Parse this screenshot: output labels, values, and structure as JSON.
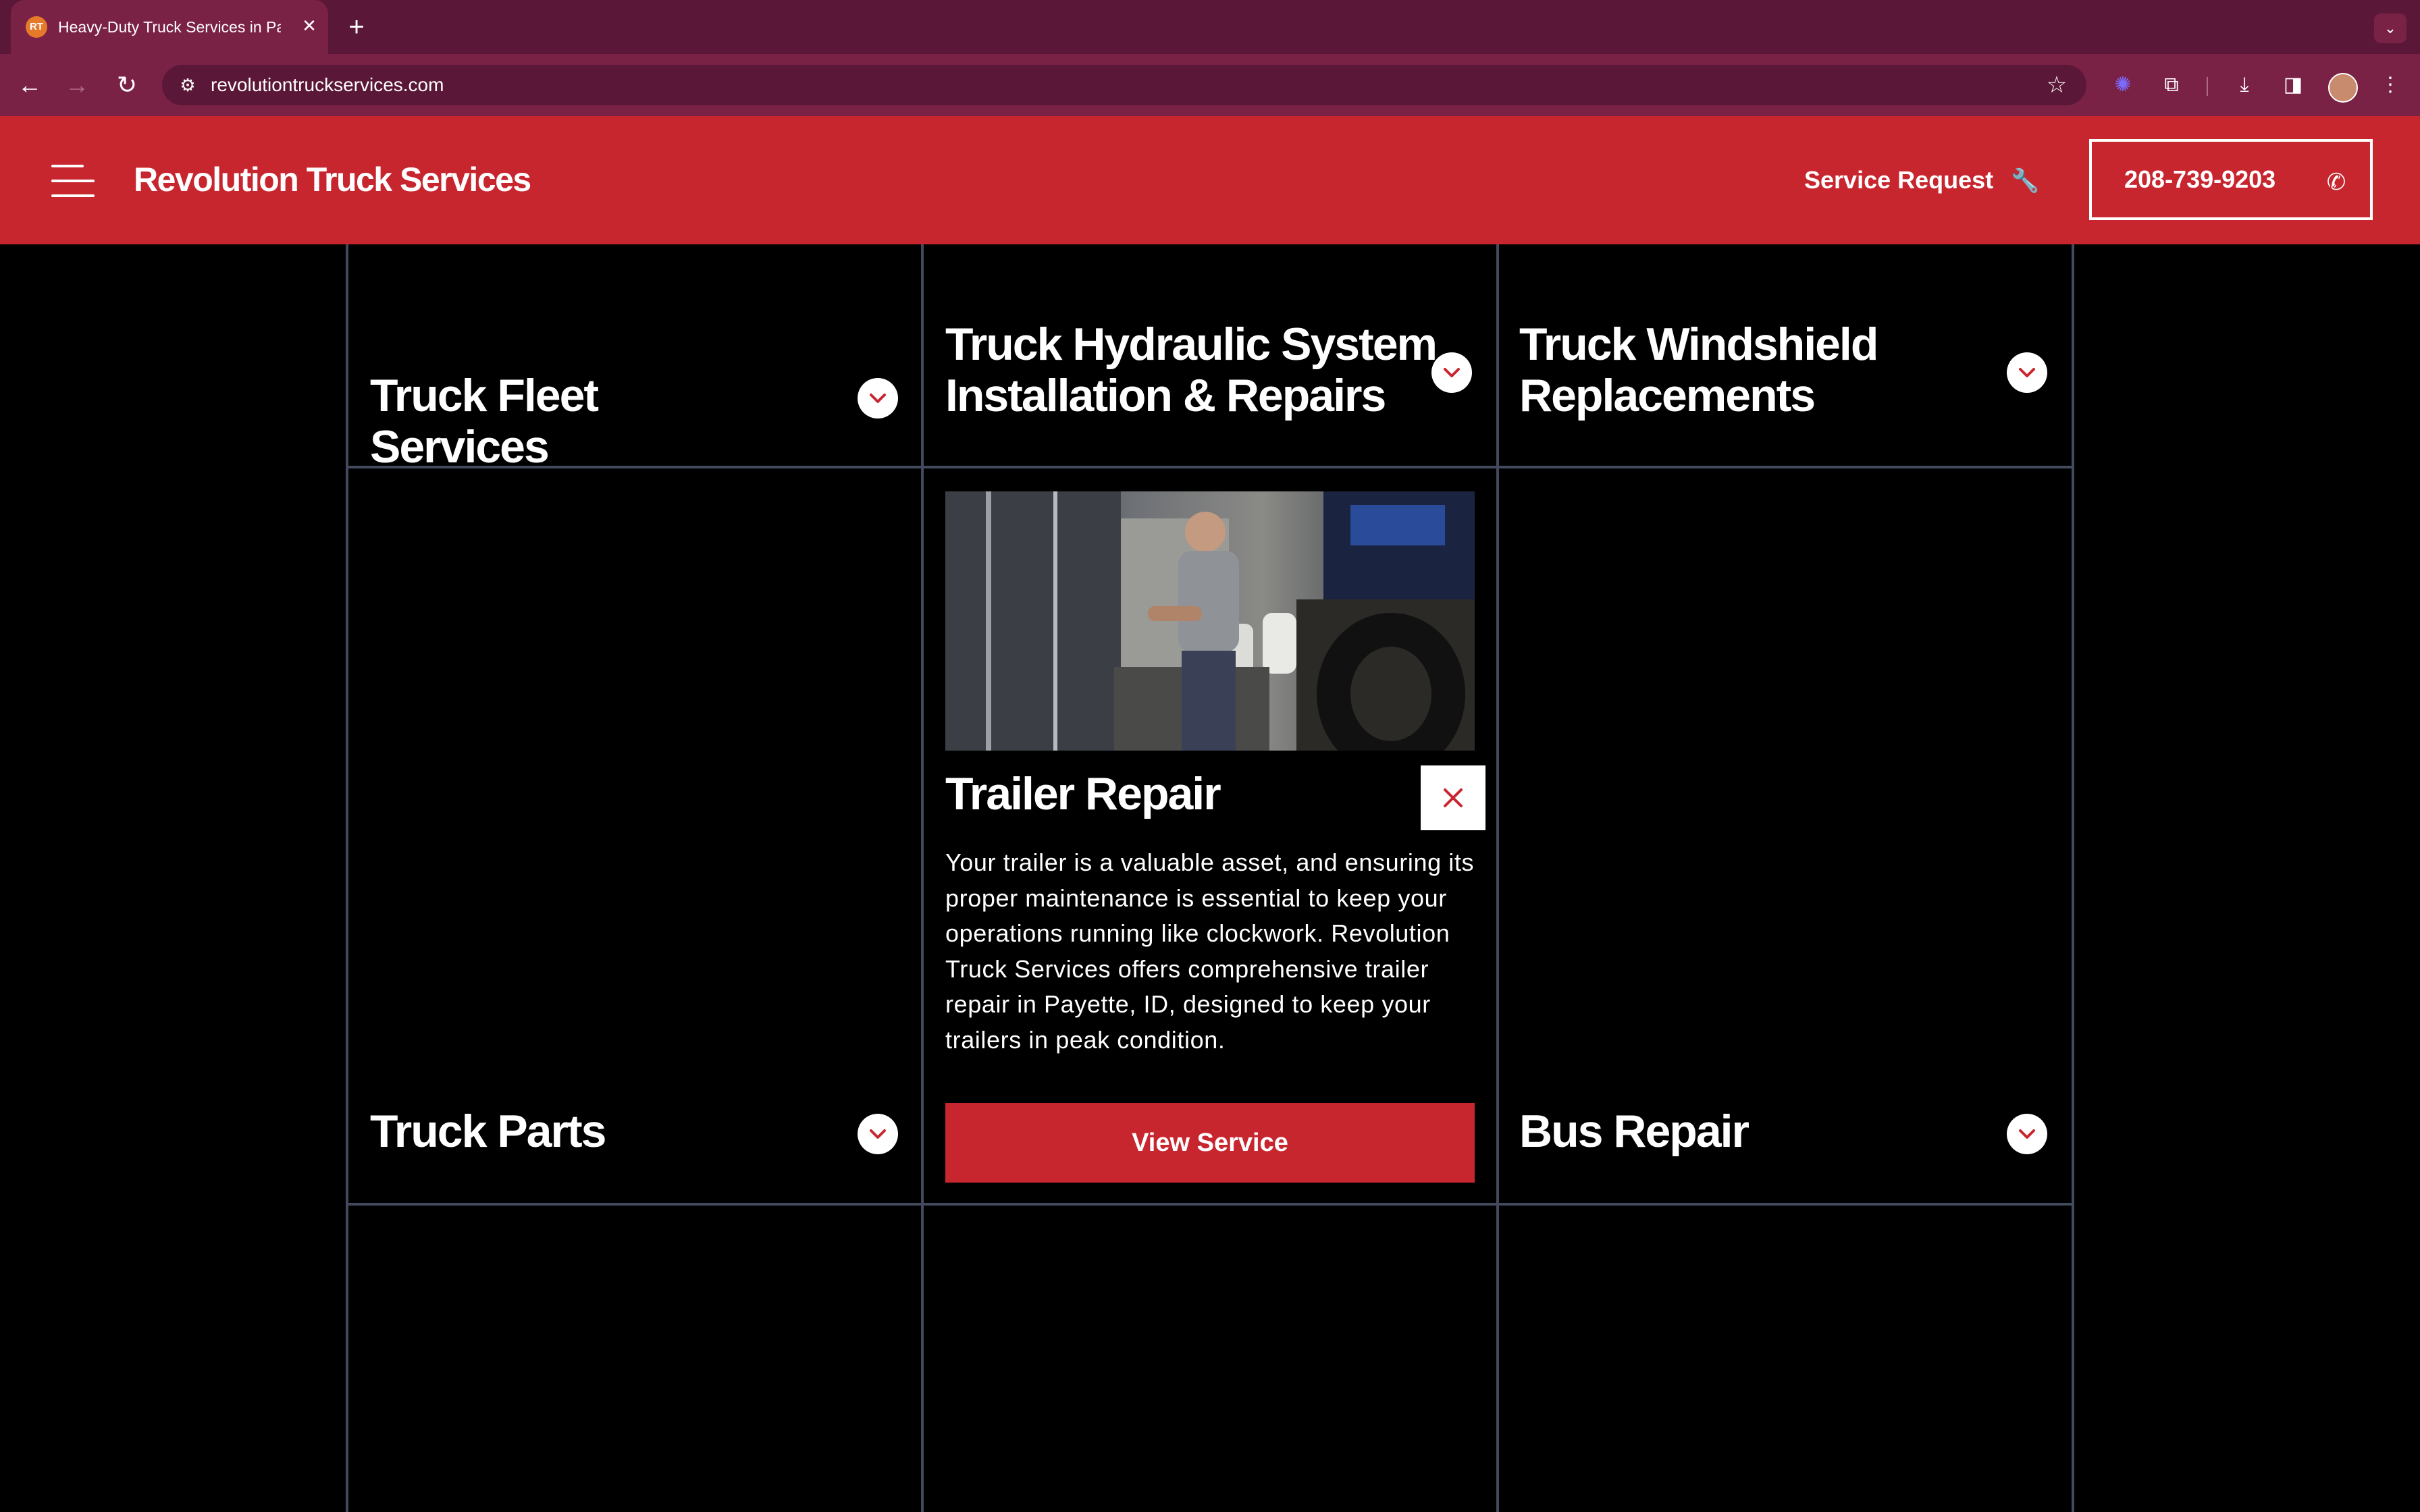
{
  "browser": {
    "tab_title": "Heavy-Duty Truck Services in Payette, ID",
    "tab_favicon_text": "RT",
    "url": "revolutiontruckservices.com"
  },
  "header": {
    "brand": "Revolution Truck Services",
    "service_request": "Service Request",
    "phone": "208-739-9203"
  },
  "services": {
    "fleet": "Truck Fleet Services",
    "hydraulic": "Truck Hydraulic System Installation & Repairs",
    "windshield": "Truck Windshield Replacements",
    "parts": "Truck Parts",
    "bus": "Bus Repair"
  },
  "expanded": {
    "title": "Trailer Repair",
    "description": "Your trailer is a valuable asset, and ensuring its proper maintenance is essential to keep your operations running like clockwork. Revolution Truck Services offers comprehensive trailer repair in Payette, ID, designed to keep your trailers in peak condition.",
    "button": "View Service"
  },
  "icons": {
    "chevron": "chevron-down-icon",
    "close": "close-icon",
    "wrench": "wrench-icon",
    "phone": "phone-icon",
    "menu": "hamburger-menu-icon"
  },
  "colors": {
    "brand_red": "#c8262f",
    "chrome": "#7a2146",
    "background": "#000000",
    "grid_line": "#434a5e"
  }
}
